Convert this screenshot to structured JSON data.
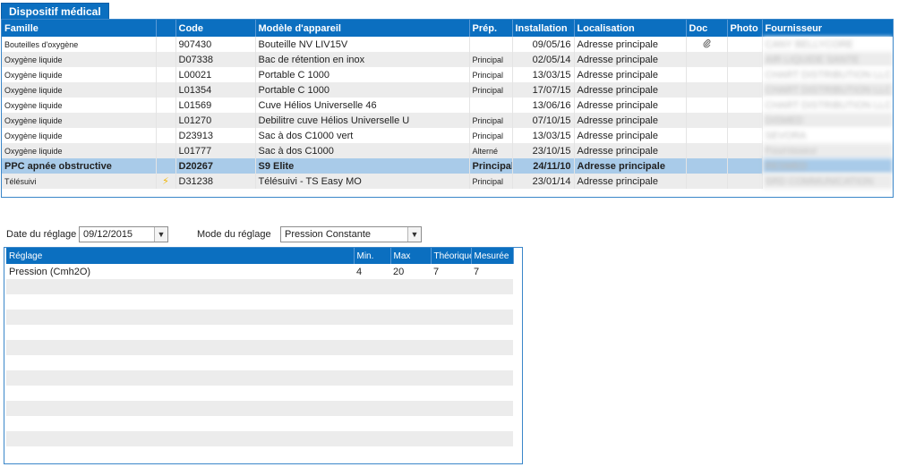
{
  "tab": {
    "label": "Dispositif médical"
  },
  "devices": {
    "headers": {
      "famille": "Famille",
      "code": "Code",
      "modele": "Modèle d'appareil",
      "prep": "Prép.",
      "installation": "Installation",
      "localisation": "Localisation",
      "doc": "Doc",
      "photo": "Photo",
      "fournisseur": "Fournisseur"
    },
    "rows": [
      {
        "famille": "Bouteilles d'oxygène",
        "icon": "",
        "code": "907430",
        "modele": "Bouteille NV LIV15V",
        "prep": "",
        "installation": "09/05/16",
        "localisation": "Adresse principale",
        "doc": "attachment",
        "fournisseur": "CANY BELLYCORE"
      },
      {
        "famille": "Oxygène liquide",
        "icon": "",
        "code": "D07338",
        "modele": "Bac de rétention en inox",
        "prep": "Principal",
        "installation": "02/05/14",
        "localisation": "Adresse principale",
        "doc": "",
        "fournisseur": "AIR LIQUIDE SANTE"
      },
      {
        "famille": "Oxygène liquide",
        "icon": "",
        "code": "L00021",
        "modele": "Portable C 1000",
        "prep": "Principal",
        "installation": "13/03/15",
        "localisation": "Adresse principale",
        "doc": "",
        "fournisseur": "CHART DISTRIBUTION LLC"
      },
      {
        "famille": "Oxygène liquide",
        "icon": "",
        "code": "L01354",
        "modele": "Portable C 1000",
        "prep": "Principal",
        "installation": "17/07/15",
        "localisation": "Adresse principale",
        "doc": "",
        "fournisseur": "CHART DISTRIBUTION LLC"
      },
      {
        "famille": "Oxygène liquide",
        "icon": "",
        "code": "L01569",
        "modele": "Cuve Hélios Universelle 46",
        "prep": "",
        "installation": "13/06/16",
        "localisation": "Adresse principale",
        "doc": "",
        "fournisseur": "CHART DISTRIBUTION LLC"
      },
      {
        "famille": "Oxygène liquide",
        "icon": "",
        "code": "L01270",
        "modele": "Debilitre cuve Hélios Universelle U",
        "prep": "Principal",
        "installation": "07/10/15",
        "localisation": "Adresse principale",
        "doc": "",
        "fournisseur": "DISMED"
      },
      {
        "famille": "Oxygène liquide",
        "icon": "",
        "code": "D23913",
        "modele": "Sac à dos C1000 vert",
        "prep": "Principal",
        "installation": "13/03/15",
        "localisation": "Adresse principale",
        "doc": "",
        "fournisseur": "SEVORA"
      },
      {
        "famille": "Oxygène liquide",
        "icon": "",
        "code": "L01777",
        "modele": "Sac à dos C1000",
        "prep": "Alterné",
        "installation": "23/10/15",
        "localisation": "Adresse principale",
        "doc": "",
        "fournisseur": "Fournisseur"
      },
      {
        "famille": "PPC apnée obstructive",
        "icon": "",
        "code": "D20267",
        "modele": "S9 Elite",
        "prep": "Principal",
        "installation": "24/11/10",
        "localisation": "Adresse principale",
        "doc": "",
        "fournisseur": "RESMED"
      },
      {
        "famille": "Télésuivi",
        "icon": "lightning",
        "code": "D31238",
        "modele": "Télésuivi - TS Easy MO",
        "prep": "Principal",
        "installation": "23/01/14",
        "localisation": "Adresse principale",
        "doc": "",
        "fournisseur": "SRD COMMUNICATION"
      }
    ],
    "selected_index": 8
  },
  "reglage": {
    "date_label": "Date du réglage",
    "date_value": "09/12/2015",
    "mode_label": "Mode du réglage",
    "mode_value": "Pression Constante"
  },
  "settings": {
    "headers": {
      "reglage": "Réglage",
      "min": "Min.",
      "max": "Max",
      "theorique": "Théorique",
      "mesuree": "Mesurée"
    },
    "rows": [
      {
        "reglage": "Pression (Cmh2O)",
        "min": "4",
        "max": "20",
        "theorique": "7",
        "mesuree": "7"
      }
    ]
  },
  "icons": {
    "dropdown": "chevron-down-icon",
    "attachment": "paperclip-icon",
    "lightning": "lightning-icon"
  },
  "colors": {
    "header": "#0b6fc0",
    "selected_row": "#a9cbe9",
    "alt_row": "#ececec"
  }
}
